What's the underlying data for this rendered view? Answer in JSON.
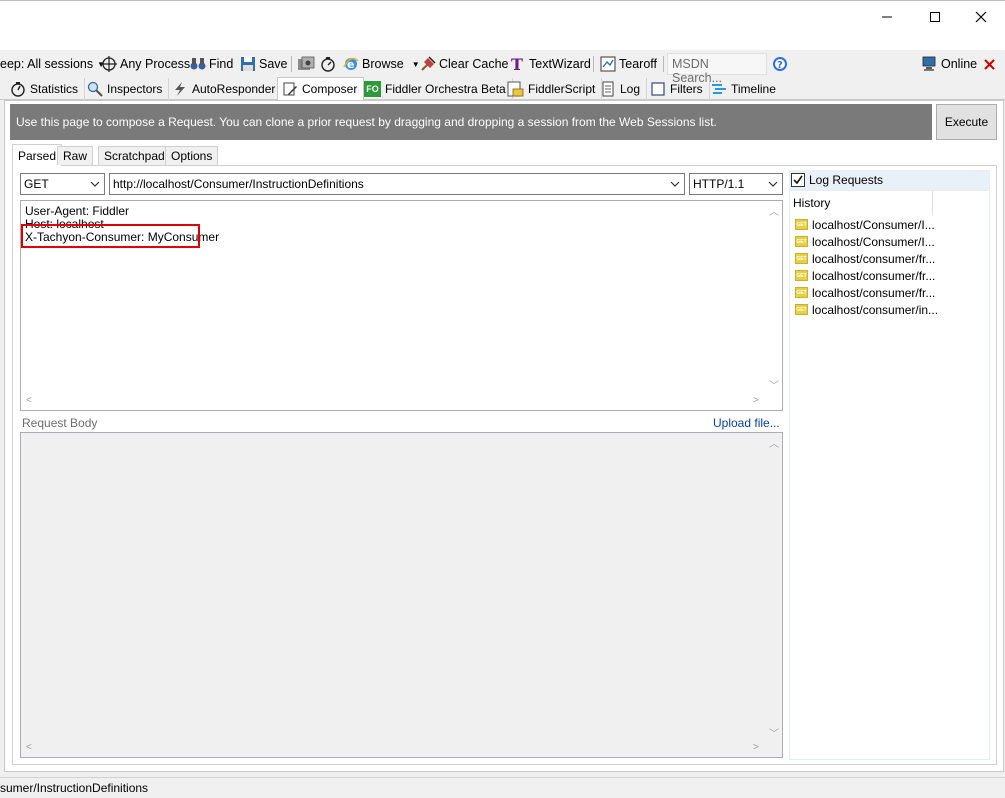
{
  "toolbar": {
    "keep_label": "eep: All sessions",
    "any_process": "Any Process",
    "find": "Find",
    "save": "Save",
    "browse": "Browse",
    "clear_cache": "Clear Cache",
    "text_wizard": "TextWizard",
    "tearoff": "Tearoff",
    "msdn_search": "MSDN Search...",
    "online": "Online"
  },
  "main_tabs": [
    {
      "label": "Statistics",
      "icon": "stopwatch-icon"
    },
    {
      "label": "Inspectors",
      "icon": "inspector-icon"
    },
    {
      "label": "AutoResponder",
      "icon": "lightning-icon"
    },
    {
      "label": "Composer",
      "icon": "pencil-icon",
      "active": true
    },
    {
      "label": "Fiddler Orchestra Beta",
      "icon": "fo-icon",
      "badge": "FO"
    },
    {
      "label": "FiddlerScript",
      "icon": "script-icon"
    },
    {
      "label": "Log",
      "icon": "log-icon"
    },
    {
      "label": "Filters",
      "icon": "checkbox-icon"
    },
    {
      "label": "Timeline",
      "icon": "timeline-icon"
    }
  ],
  "composer": {
    "info": "Use this page to compose a Request. You can clone a prior request by dragging and dropping a session from the Web Sessions list.",
    "execute": "Execute",
    "sub_tabs": [
      "Parsed",
      "Raw",
      "Scratchpad",
      "Options"
    ],
    "method": "GET",
    "url": "http://localhost/Consumer/InstructionDefinitions",
    "http_version": "HTTP/1.1",
    "headers": [
      "User-Agent: Fiddler",
      "Host: localhost",
      "X-Tachyon-Consumer: MyConsumer"
    ],
    "request_body_label": "Request Body",
    "upload_file": "Upload file...",
    "log_requests": "Log Requests",
    "history_title": "History",
    "get_badge": "GET",
    "history": [
      "localhost/Consumer/I...",
      "localhost/Consumer/I...",
      "localhost/consumer/fr...",
      "localhost/consumer/fr...",
      "localhost/consumer/fr...",
      "localhost/consumer/in..."
    ]
  },
  "status_bar": {
    "text": "sumer/InstructionDefinitions"
  },
  "colors": {
    "info_bar": "#7a7a7a",
    "highlight": "#e00000",
    "link": "#0a3ea8",
    "close_x": "#d00000"
  }
}
